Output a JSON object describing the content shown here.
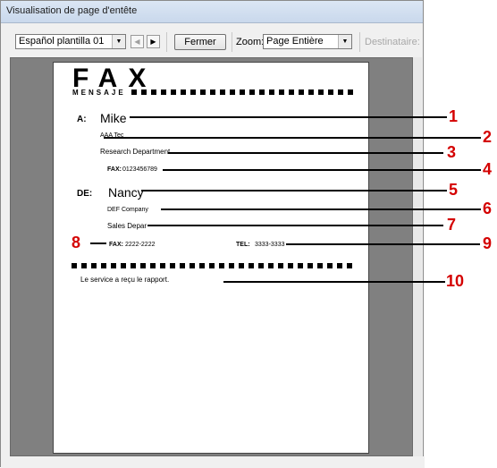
{
  "window": {
    "title": "Visualisation de page d'entête"
  },
  "toolbar": {
    "template_select": "Español plantilla 01",
    "prev_icon": "triangle-left",
    "next_icon": "triangle-right",
    "close_label": "Fermer",
    "zoom_label": "Zoom:",
    "zoom_select": "Page Entière",
    "recipient_label": "Destinataire:"
  },
  "cover": {
    "title": "FAX",
    "subtitle": "MENSAJE",
    "to_label": "A:",
    "to_name": "Mike",
    "to_company": "AAA Tec",
    "to_department": "Research Department",
    "to_fax_label": "FAX:",
    "to_fax_number": "0123456789",
    "from_label": "DE:",
    "from_name": "Nancy",
    "from_company": "DEF Company",
    "from_department": "Sales Depar",
    "from_fax_label": "FAX:",
    "from_fax_number": "2222-2222",
    "from_tel_label": "TEL:",
    "from_tel_number": "3333-3333",
    "comment": "Le service a reçu le rapport."
  },
  "callouts": [
    "1",
    "2",
    "3",
    "4",
    "5",
    "6",
    "7",
    "8",
    "9",
    "10"
  ],
  "colors": {
    "callout": "#d40000",
    "preview_bg": "#808080"
  }
}
